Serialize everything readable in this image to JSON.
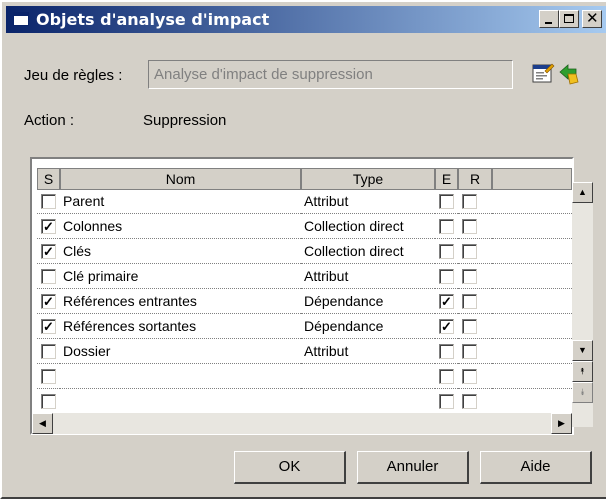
{
  "window": {
    "title": "Objets d'analyse d'impact"
  },
  "ruleset": {
    "label": "Jeu de règles :",
    "value": "Analyse d'impact de suppression"
  },
  "action": {
    "label": "Action :",
    "value": "Suppression"
  },
  "grid": {
    "columns": [
      "S",
      "Nom",
      "Type",
      "E",
      "R"
    ],
    "rows": [
      {
        "s": false,
        "name": "Parent",
        "type": "Attribut",
        "e": false,
        "r": false
      },
      {
        "s": true,
        "name": "Colonnes",
        "type": "Collection direct",
        "e": false,
        "r": false
      },
      {
        "s": true,
        "name": "Clés",
        "type": "Collection direct",
        "e": false,
        "r": false
      },
      {
        "s": false,
        "name": "Clé primaire",
        "type": "Attribut",
        "e": false,
        "r": false
      },
      {
        "s": true,
        "name": "Références entrantes",
        "type": "Dépendance",
        "e": true,
        "r": false
      },
      {
        "s": true,
        "name": "Références sortantes",
        "type": "Dépendance",
        "e": true,
        "r": false
      },
      {
        "s": false,
        "name": "Dossier",
        "type": "Attribut",
        "e": false,
        "r": false
      },
      {
        "s": false,
        "name": "",
        "type": "",
        "e": false,
        "r": false
      },
      {
        "s": false,
        "name": "",
        "type": "",
        "e": false,
        "r": false
      }
    ]
  },
  "buttons": {
    "ok": "OK",
    "cancel": "Annuler",
    "help": "Aide"
  }
}
